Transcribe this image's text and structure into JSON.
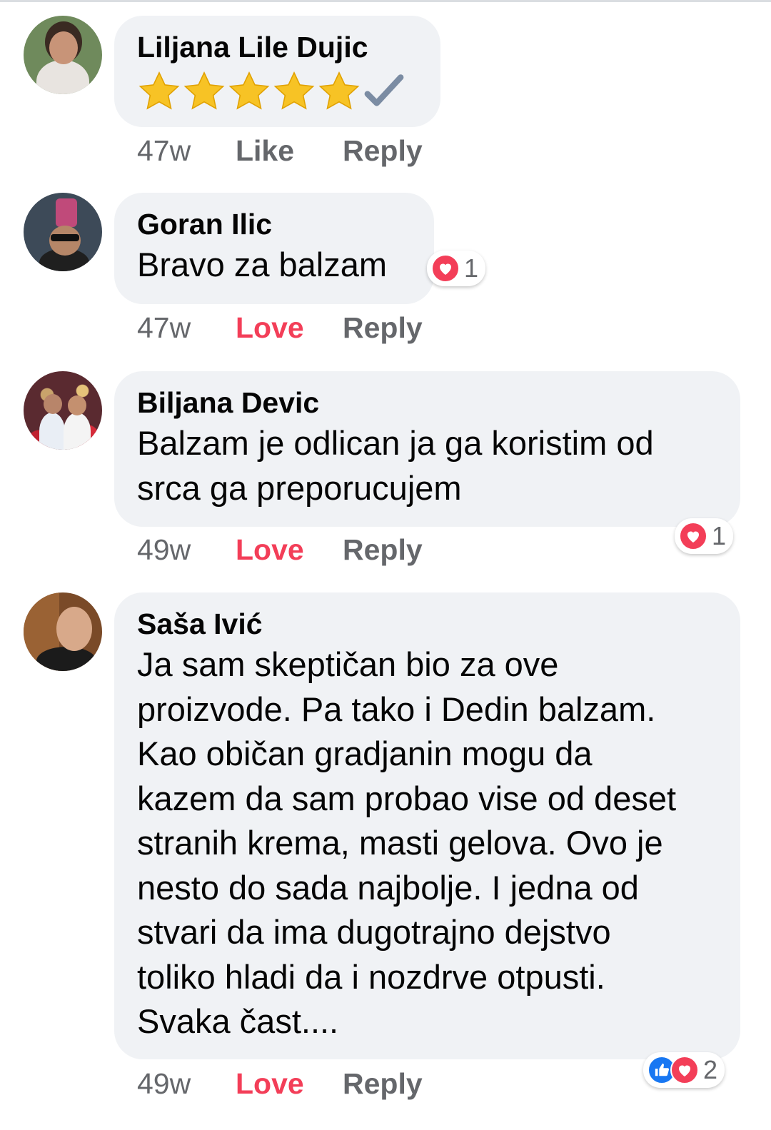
{
  "comments": [
    {
      "author": "Liljana Lile Dujic",
      "rating_stars": 5,
      "check_mark": true,
      "time": "47w",
      "reaction_action": "Like",
      "reply": "Reply"
    },
    {
      "author": "Goran Ilic",
      "text": "Bravo za balzam",
      "time": "47w",
      "reaction_action": "Love",
      "reply": "Reply",
      "reaction_count": "1"
    },
    {
      "author": "Biljana Devic",
      "text": "Balzam je odlican ja ga koristim od\nsrca ga preporucujem",
      "time": "49w",
      "reaction_action": "Love",
      "reply": "Reply",
      "reaction_count": "1"
    },
    {
      "author": "Saša Ivić",
      "text": "Ja sam skeptičan bio za ove\nproizvode. Pa tako i Dedin balzam.\nKao običan gradjanin mogu da\nkazem da sam probao vise od deset\nstranih krema, masti gelova. Ovo je\nnesto do sada najbolje. I jedna od\nstvari da ima dugotrajno dejstvo\ntoliko hladi da i nozdrve otpusti.\nSvaka čast....",
      "time": "49w",
      "reaction_action": "Love",
      "reply": "Reply",
      "reaction_count": "2"
    }
  ],
  "colors": {
    "love": "#f33e58",
    "like": "#1877f2",
    "bubble": "#f0f2f5",
    "meta": "#65676b"
  },
  "icons": [
    "star-icon",
    "check-mark-icon",
    "heart-icon",
    "thumbs-up-icon"
  ]
}
